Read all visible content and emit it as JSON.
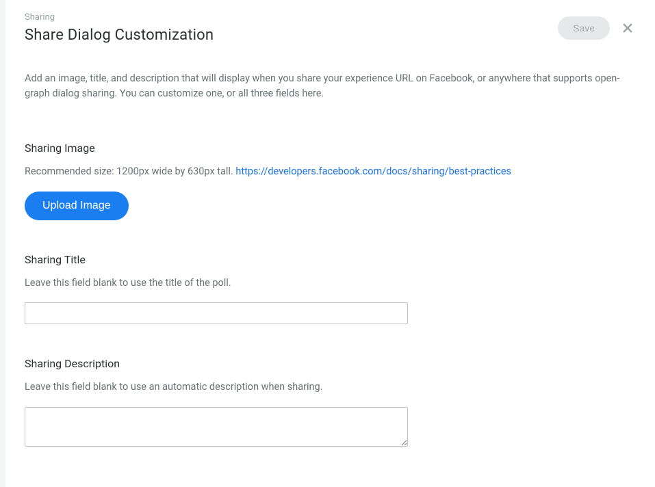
{
  "header": {
    "breadcrumb": "Sharing",
    "title": "Share Dialog Customization",
    "save_label": "Save"
  },
  "intro": {
    "text": "Add an image, title, and description that will display when you share your experience URL on Facebook, or anywhere that supports open-graph dialog sharing. You can customize one, or all three fields here."
  },
  "sections": {
    "image": {
      "heading": "Sharing Image",
      "hint_prefix": "Recommended size: 1200px wide by 630px tall. ",
      "link_text": "https://developers.facebook.com/docs/sharing/best-practices",
      "upload_label": "Upload Image"
    },
    "title": {
      "heading": "Sharing Title",
      "hint": "Leave this field blank to use the title of the poll.",
      "value": ""
    },
    "description": {
      "heading": "Sharing Description",
      "hint": "Leave this field blank to use an automatic description when sharing.",
      "value": ""
    }
  }
}
